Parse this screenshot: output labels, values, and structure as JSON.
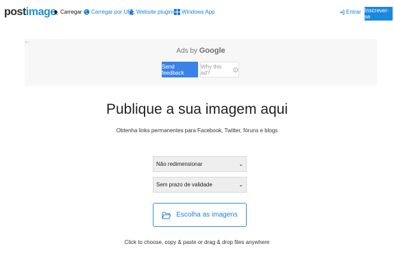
{
  "nav": {
    "logo_left": "post",
    "logo_right": "image",
    "items": [
      {
        "label": "Carregar"
      },
      {
        "label": "Carregar por URL"
      },
      {
        "label": "Website plugins"
      },
      {
        "label": "Windows App"
      }
    ],
    "login": "Entrar",
    "signup": "Inscrever-se"
  },
  "ad": {
    "back": "←",
    "ads_by": "Ads by",
    "brand": "Google",
    "feedback": "Send feedback",
    "why": "Why this ad?"
  },
  "main": {
    "title": "Publique a sua imagem aqui",
    "subtitle": "Obtenha links permanentes para Facebook, Twitter, fóruns e blogs",
    "resize_select": "Não redimensionar",
    "expiry_select": "Sem prazo de validade",
    "choose_button": "Escolha as imagens",
    "hint": "Click to choose, copy & paste or drag & drop files anywhere"
  },
  "colors": {
    "accent": "#1a88e0",
    "ad_button": "#3b82e6"
  }
}
